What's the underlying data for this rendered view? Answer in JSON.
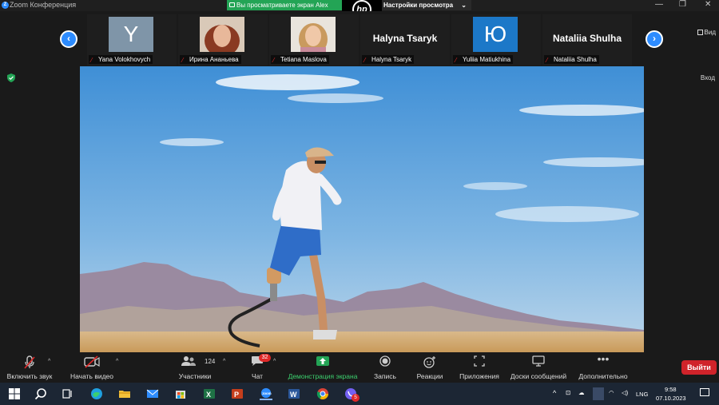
{
  "window": {
    "app_title": "Zoom Конференция",
    "share_banner": "Вы просматриваете экран Alex",
    "view_settings": "Настройки просмотра",
    "view_button": "Вид",
    "exit_label": "Вход"
  },
  "gallery": {
    "participants": [
      {
        "name": "Yana Volokhovych",
        "avatar_type": "letter",
        "avatar_text": "Y",
        "avatar_color": "#7f95a8"
      },
      {
        "name": "Ирина Ананьева",
        "avatar_type": "photo",
        "avatar_color": "#b8604a"
      },
      {
        "name": "Tetiana Maslova",
        "avatar_type": "photo",
        "avatar_color": "#c9a07a"
      },
      {
        "name": "Halyna Tsaryk",
        "avatar_type": "name",
        "avatar_text": "Halyna Tsaryk"
      },
      {
        "name": "Yuliia Matiukhina",
        "avatar_type": "letter",
        "avatar_text": "Ю",
        "avatar_color": "#1c78c8"
      },
      {
        "name": "Nataliia Shulha",
        "avatar_type": "name",
        "avatar_text": "Nataliia Shulha"
      }
    ]
  },
  "toolbar": {
    "unmute": "Включить звук",
    "start_video": "Начать видео",
    "participants": "Участники",
    "participants_count": "124",
    "chat": "Чат",
    "chat_badge": "32",
    "share_screen": "Демонстрация экрана",
    "record": "Запись",
    "reactions": "Реакции",
    "apps": "Приложения",
    "whiteboards": "Доски сообщений",
    "more": "Дополнительно",
    "leave": "Выйти"
  },
  "taskbar": {
    "lang": "LNG",
    "time": "9:58",
    "date": "07.10.2023",
    "viber_badge": "5"
  },
  "colors": {
    "accent": "#2d8cff",
    "share_green": "#23a455",
    "leave_red": "#d0232a",
    "muted_red": "#e02828"
  }
}
